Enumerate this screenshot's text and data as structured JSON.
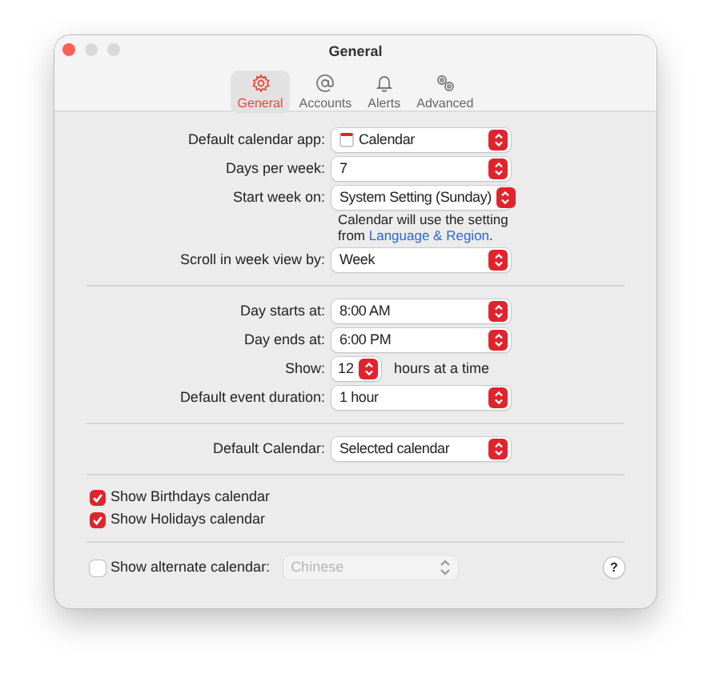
{
  "window": {
    "title": "General"
  },
  "tabs": [
    {
      "label": "General",
      "kind": "gear",
      "selected": true
    },
    {
      "label": "Accounts",
      "kind": "at",
      "selected": false
    },
    {
      "label": "Alerts",
      "kind": "bell",
      "selected": false
    },
    {
      "label": "Advanced",
      "kind": "gears",
      "selected": false
    }
  ],
  "groups": [
    {
      "rows": [
        {
          "kind": "popup",
          "label": "Default calendar app:",
          "value": "Calendar",
          "app_icon": true
        },
        {
          "kind": "popup",
          "label": "Days per week:",
          "value": "7"
        },
        {
          "kind": "popup",
          "label": "Start week on:",
          "value": "System Setting (Sunday)",
          "note": {
            "text": "Calendar will use the setting from",
            "link": "Language & Region",
            "after": "."
          }
        },
        {
          "kind": "popup",
          "label": "Scroll in week view by:",
          "value": "Week"
        }
      ]
    },
    {
      "rows": [
        {
          "kind": "popup",
          "label": "Day starts at:",
          "value": "8:00 AM"
        },
        {
          "kind": "popup",
          "label": "Day ends at:",
          "value": "6:00 PM"
        },
        {
          "kind": "stepper",
          "label": "Show:",
          "value": "12",
          "suffix": "hours at a time"
        },
        {
          "kind": "popup",
          "label": "Default event duration:",
          "value": "1 hour"
        }
      ]
    },
    {
      "rows": [
        {
          "kind": "popup",
          "label": "Default Calendar:",
          "value": "Selected calendar"
        }
      ]
    }
  ],
  "checkboxes": [
    {
      "label": "Show Birthdays calendar",
      "checked": true
    },
    {
      "label": "Show Holidays calendar",
      "checked": true
    }
  ],
  "alternate": {
    "label": "Show alternate calendar:",
    "checked": false,
    "value": "Chinese",
    "disabled": true
  },
  "help": "?"
}
